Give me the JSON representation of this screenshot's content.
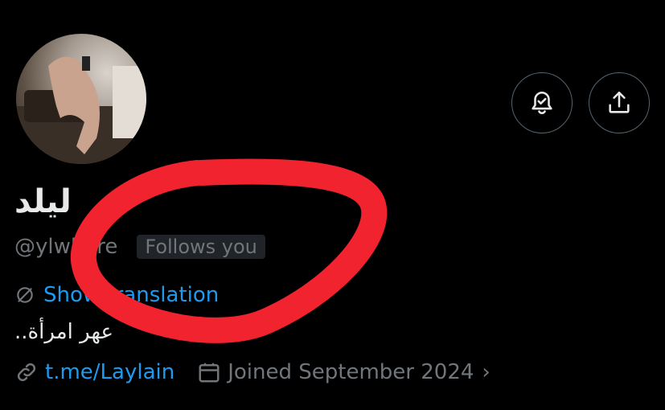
{
  "profile": {
    "display_name": "ليلد",
    "handle": "@ylwhore",
    "follows_badge": "Follows you",
    "translate_label": "Show translation",
    "bio": "عهر امرأة..",
    "link": "t.me/Laylain",
    "joined": "Joined September 2024"
  },
  "icons": {
    "notify": "bell-check-icon",
    "share": "share-icon",
    "translate": "translate-icon",
    "link": "link-icon",
    "calendar": "calendar-icon",
    "chevron": "chevron-right-icon"
  },
  "colors": {
    "background": "#000000",
    "text_primary": "#e7e9ea",
    "text_secondary": "#71767b",
    "link": "#1d9bf0",
    "annotation": "#f0232f"
  }
}
